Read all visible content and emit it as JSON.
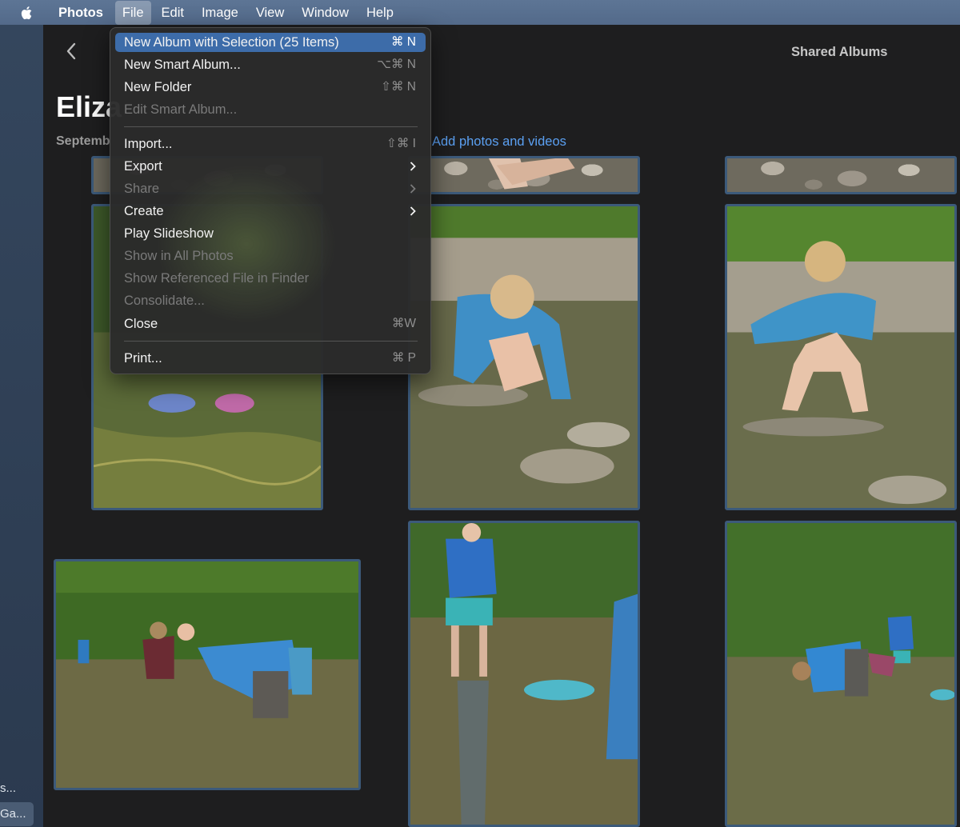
{
  "menubar": {
    "app_name": "Photos",
    "items": [
      "File",
      "Edit",
      "Image",
      "View",
      "Window",
      "Help"
    ]
  },
  "header": {
    "title": "Eliza",
    "subtitle": "Septemb",
    "add_link": "Add photos and videos",
    "shared_albums": "Shared Albums"
  },
  "sidebar": {
    "truncated_item": "s...",
    "selected_item": "Ga..."
  },
  "file_menu": {
    "items": [
      {
        "label": "New Album with Selection (25 Items)",
        "shortcut": "⌘ N",
        "enabled": true,
        "highlighted": true
      },
      {
        "label": "New Smart Album...",
        "shortcut": "⌥⌘ N",
        "enabled": true
      },
      {
        "label": "New Folder",
        "shortcut": "⇧⌘ N",
        "enabled": true
      },
      {
        "label": "Edit Smart Album...",
        "shortcut": "",
        "enabled": false
      },
      {
        "label": "Import...",
        "shortcut": "⇧⌘ I",
        "enabled": true
      },
      {
        "label": "Export",
        "submenu": true,
        "enabled": true
      },
      {
        "label": "Share",
        "submenu": true,
        "enabled": false
      },
      {
        "label": "Create",
        "submenu": true,
        "enabled": true
      },
      {
        "label": "Play Slideshow",
        "shortcut": "",
        "enabled": true
      },
      {
        "label": "Show in All Photos",
        "shortcut": "",
        "enabled": false
      },
      {
        "label": "Show Referenced File in Finder",
        "shortcut": "",
        "enabled": false
      },
      {
        "label": "Consolidate...",
        "shortcut": "",
        "enabled": false
      },
      {
        "label": "Close",
        "shortcut": "⌘W",
        "enabled": true
      },
      {
        "label": "Print...",
        "shortcut": "⌘ P",
        "enabled": true
      }
    ]
  },
  "colors": {
    "menubar": "#5a7292",
    "menu_highlight": "#3d6ca9",
    "link": "#5ba0f2",
    "photo_border": "#3c5a7a"
  }
}
